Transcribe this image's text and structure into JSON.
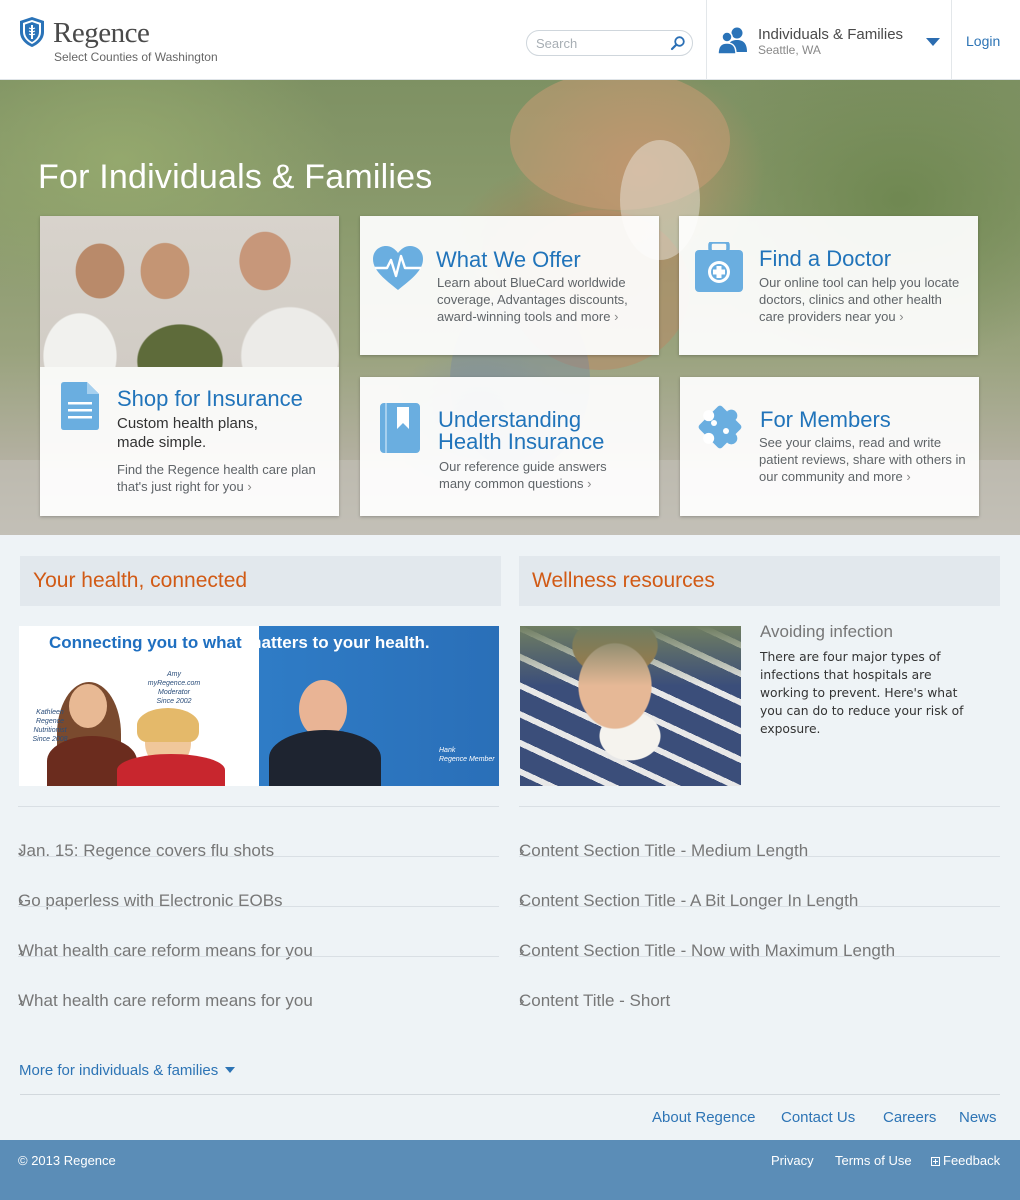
{
  "header": {
    "brand": "Regence",
    "subtitle": "Select Counties of Washington",
    "search_placeholder": "Search",
    "audience": {
      "title": "Individuals & Families",
      "location": "Seattle, WA"
    },
    "login": "Login"
  },
  "hero": {
    "title": "For Individuals & Families",
    "cards": {
      "shop": {
        "title": "Shop for Insurance",
        "tagline_1": "Custom health plans,",
        "tagline_2": "made simple.",
        "desc": "Find the Regence health care plan that's just right for you"
      },
      "offer": {
        "title": "What We Offer",
        "desc": "Learn about BlueCard worldwide coverage, Advantages discounts, award-winning tools and more"
      },
      "doctor": {
        "title": "Find a Doctor",
        "desc": "Our online tool can help you locate doctors, clinics and other health care providers near you"
      },
      "understanding": {
        "title_1": "Understanding",
        "title_2": "Health Insurance",
        "desc": "Our reference guide answers many common questions"
      },
      "members": {
        "title": "For Members",
        "desc": "See your claims, read and write patient reviews, share with others in our community and more"
      }
    }
  },
  "left": {
    "heading": "Your health, connected",
    "banner": {
      "title_a": "Connecting you to what ",
      "title_b": "matters to your health.",
      "kathleen": "Kathleen\nRegence\nNutritionist\nSince 2008",
      "amy": "Amy\nmyRegence.com\nModerator\nSince 2002",
      "hank": "Hank\nRegence Member"
    },
    "links": [
      "Jan. 15: Regence covers flu shots",
      "Go paperless with Electronic EOBs",
      "What health care reform means for you",
      "What health care reform means for you"
    ]
  },
  "right": {
    "heading": "Wellness resources",
    "article": {
      "title": "Avoiding infection",
      "text": "There are four major types of infections that hospitals are working to prevent. Here's what you can do to reduce your risk of exposure."
    },
    "links": [
      "Content Section Title - Medium Length",
      "Content Section Title - A Bit Longer In Length",
      "Content Section Title - Now with Maximum Length",
      "Content Title - Short"
    ]
  },
  "more_link": "More for individuals & families",
  "footer_links": {
    "about": "About Regence",
    "contact": "Contact Us",
    "careers": "Careers",
    "news": "News"
  },
  "footer": {
    "copyright": "© 2013 Regence",
    "privacy": "Privacy",
    "terms": "Terms of Use",
    "feedback": "Feedback"
  },
  "colors": {
    "brand_blue": "#2174ba",
    "accent_orange": "#d15a15",
    "footer_blue": "#5b8db7"
  },
  "icons": [
    "shield-logo-icon",
    "search-icon",
    "people-icon",
    "chevron-down-icon",
    "document-icon",
    "heart-pulse-icon",
    "medical-kit-icon",
    "book-icon",
    "puzzle-icon",
    "chevron-right-icon",
    "feedback-plus-icon"
  ]
}
